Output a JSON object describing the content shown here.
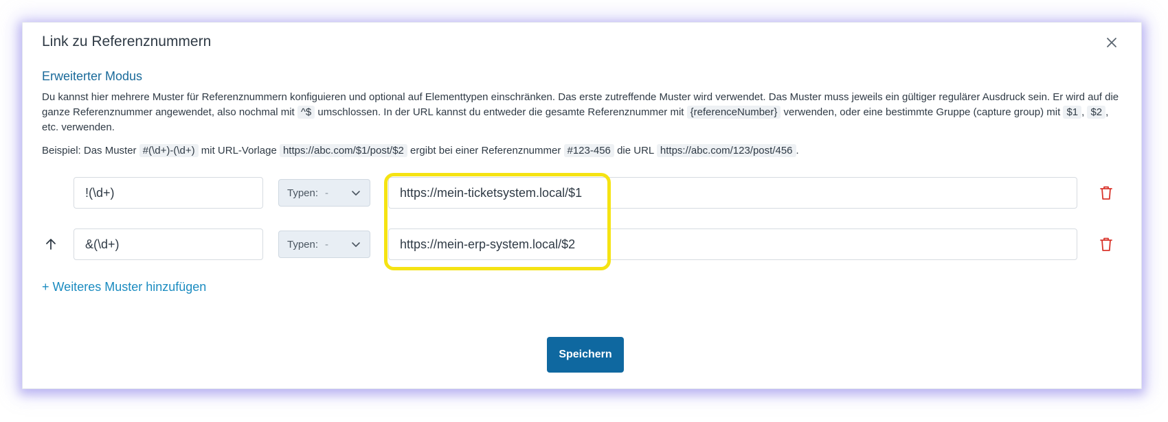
{
  "modal": {
    "title": "Link zu Referenznummern"
  },
  "section": {
    "title": "Erweiterter Modus"
  },
  "description": {
    "part1": "Du kannst hier mehrere Muster für Referenznummern konfiguieren und optional auf Elementtypen einschränken. Das erste zutreffende Muster wird verwendet. Das Muster muss jeweils ein gültiger regulärer Ausdruck sein. Er wird auf die ganze Referenznummer angewendet, also nochmal mit ",
    "code1": "^$",
    "part2": " umschlossen. In der URL kannst du entweder die gesamte Referenznummer mit ",
    "code2": "{referenceNumber}",
    "part3": " verwenden, oder eine bestimmte Gruppe (capture group) mit ",
    "code3": "$1",
    "part4": ", ",
    "code4": "$2",
    "part5": ", etc. verwenden."
  },
  "example": {
    "part1": "Beispiel: Das Muster ",
    "code1": "#(\\d+)-(\\d+)",
    "part2": " mit URL-Vorlage ",
    "code2": "https://abc.com/$1/post/$2",
    "part3": " ergibt bei einer Referenznummer ",
    "code3": "#123-456",
    "part4": " die URL ",
    "code4": "https://abc.com/123/post/456",
    "part5": "."
  },
  "patterns": [
    {
      "pattern": "!(\\d+)",
      "types_label": "Typen:",
      "types_value": "-",
      "url": "https://mein-ticketsystem.local/$1"
    },
    {
      "pattern": "&(\\d+)",
      "types_label": "Typen:",
      "types_value": "-",
      "url": "https://mein-erp-system.local/$2"
    }
  ],
  "add_pattern_label": "+ Weiteres Muster hinzufügen",
  "save_label": "Speichern",
  "colors": {
    "accent": "#0f68a0",
    "link": "#1a8bc0",
    "section_title": "#1a6a9a",
    "delete": "#d9342b",
    "highlight": "#f5e313"
  },
  "icons": {
    "close": "close-icon",
    "move_up": "arrow-up-icon",
    "dropdown": "chevron-down-icon",
    "delete": "trash-icon"
  }
}
